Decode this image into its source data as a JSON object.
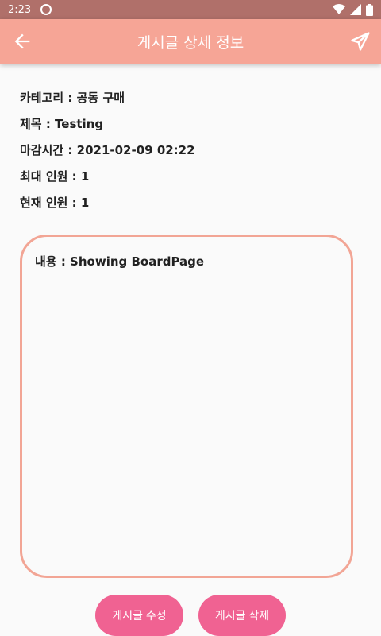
{
  "status_bar": {
    "time": "2:23"
  },
  "app_bar": {
    "title": "게시글 상세 정보"
  },
  "post": {
    "category_label": "카테고리 : 공동 구매",
    "title_label": "제목 : Testing",
    "deadline_label": "마감시간 : 2021-02-09 02:22",
    "max_people_label": "최대 인원 : 1",
    "current_people_label": "현재 인원 : 1",
    "content_label": "내용 : Showing BoardPage"
  },
  "actions": {
    "edit_label": "게시글 수정",
    "delete_label": "게시글 삭제"
  },
  "colors": {
    "app_bar": "#f6a596",
    "status_bar": "#b0706a",
    "button": "#f06292",
    "box_border": "#f2a595"
  }
}
